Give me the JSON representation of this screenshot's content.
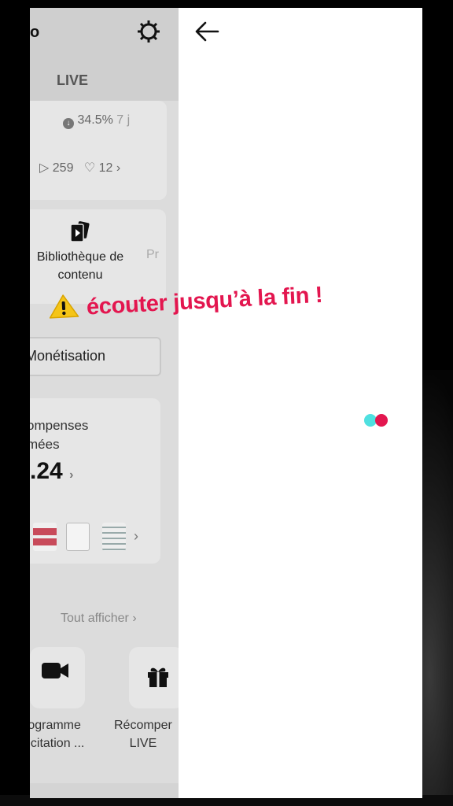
{
  "header": {
    "clip_text": "o",
    "live_tab": "LIVE"
  },
  "stats": {
    "percent": "34.5%",
    "period": "7 j",
    "plays": "259",
    "likes": "12",
    "chevron": "›"
  },
  "tools": {
    "library_label": "Bibliothèque de contenu",
    "next_clipped": "Pr"
  },
  "monetization": {
    "label": "Monétisation"
  },
  "rewards": {
    "title_line1": "ompenses",
    "title_line2": "mées",
    "amount": ".24",
    "chevron": "›"
  },
  "features": {
    "see_all": "Tout afficher ›",
    "program_line1": "rogramme",
    "program_line2": "ncitation ...",
    "live_rewards_line1": "Récomper",
    "live_rewards_line2": "LIVE"
  },
  "overlay": {
    "caption": "écouter jusqu’à la fin !"
  },
  "colors": {
    "accent_red": "#e3164f",
    "accent_cyan": "#4fe0e0"
  }
}
